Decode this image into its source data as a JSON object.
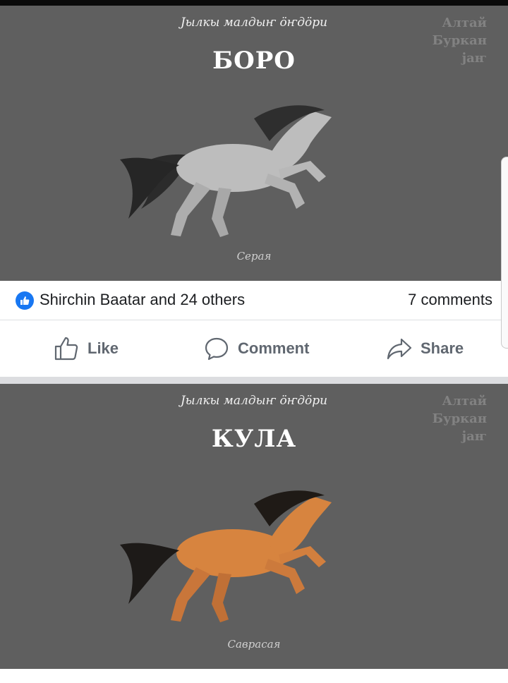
{
  "posts": [
    {
      "image": {
        "subtitle": "Јылкы малдыҥ öҥдöри",
        "title": "БОРО",
        "caption": "Серая",
        "watermark": [
          "Алтай",
          "Буркан",
          "јаҥ"
        ],
        "horse_color": "#bdbdbd"
      },
      "reactions": {
        "likes_text": "Shirchin Baatar and 24 others",
        "comments_text": "7 comments"
      },
      "actions": {
        "like": "Like",
        "comment": "Comment",
        "share": "Share"
      }
    },
    {
      "image": {
        "subtitle": "Јылкы малдыҥ öҥдöри",
        "title": "КУЛА",
        "caption": "Саврасая",
        "watermark": [
          "Алтай",
          "Буркан",
          "јаҥ"
        ],
        "horse_color": "#d7843f"
      }
    }
  ],
  "colors": {
    "accent": "#1877f2",
    "image_bg": "#5f5f5f",
    "action_text": "#606770"
  },
  "icons": [
    "like-badge-icon",
    "thumbs-up-icon",
    "comment-bubble-icon",
    "share-arrow-icon"
  ]
}
